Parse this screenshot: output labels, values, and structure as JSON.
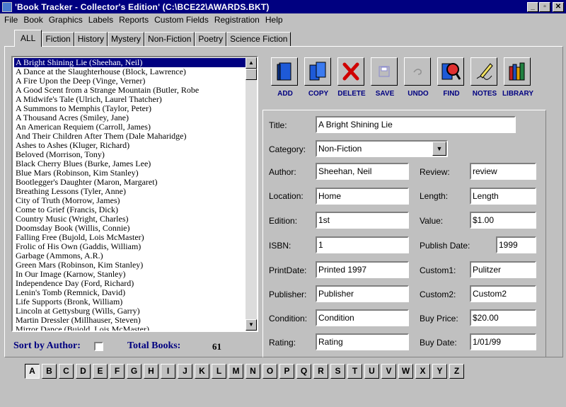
{
  "window": {
    "title": "'Book Tracker - Collector's Edition'    (C:\\BCE22\\AWARDS.BKT)"
  },
  "menu": [
    "File",
    "Book",
    "Graphics",
    "Labels",
    "Reports",
    "Custom Fields",
    "Registration",
    "Help"
  ],
  "tabs": [
    "ALL",
    "Fiction",
    "History",
    "Mystery",
    "Non-Fiction",
    "Poetry",
    "Science Fiction"
  ],
  "books": [
    "A Bright Shining Lie (Sheehan, Neil)",
    "A Dance at the Slaughterhouse (Block, Lawrence)",
    "A Fire Upon the Deep (Vinge, Verner)",
    "A Good Scent from a Strange Mountain (Butler, Robe",
    "A Midwife's Tale (Ulrich, Laurel Thatcher)",
    "A Summons to Memphis (Taylor, Peter)",
    "A Thousand Acres (Smiley, Jane)",
    "An American Requiem (Carroll, James)",
    "And Their Children After Them (Dale Maharidge)",
    "Ashes to Ashes (Kluger, Richard)",
    "Beloved (Morrison, Tony)",
    "Black Cherry Blues (Burke, James Lee)",
    "Blue Mars (Robinson, Kim Stanley)",
    "Bootlegger's Daughter (Maron, Margaret)",
    "Breathing Lessons (Tyler, Anne)",
    "City of Truth (Morrow, James)",
    "Come to Grief (Francis, Dick)",
    "Country Music (Wright, Charles)",
    "Doomsday Book (Willis, Connie)",
    "Falling Free (Bujold, Lois McMaster)",
    "Frolic of His Own (Gaddis, William)",
    "Garbage (Ammons, A.R.)",
    "Green Mars (Robinson, Kim Stanley)",
    "In Our Image (Karnow, Stanley)",
    "Independence Day (Ford, Richard)",
    "Lenin's Tomb (Remnick, David)",
    "Life Supports (Bronk, William)",
    "Lincoln at Gettysburg (Wills, Garry)",
    "Martin Dressler (Millhauser, Steven)",
    "Mirror Dance (Bujold, Lois McMaster)"
  ],
  "sort": {
    "label": "Sort by Author:"
  },
  "total": {
    "label": "Total Books:",
    "value": "61"
  },
  "toolbar": [
    "ADD",
    "COPY",
    "DELETE",
    "SAVE",
    "UNDO",
    "FIND",
    "NOTES",
    "LIBRARY"
  ],
  "form": {
    "title_label": "Title:",
    "title": "A Bright Shining Lie",
    "category_label": "Category:",
    "category": "Non-Fiction",
    "author_label": "Author:",
    "author": "Sheehan, Neil",
    "review_label": "Review:",
    "review": "review",
    "location_label": "Location:",
    "location": "Home",
    "length_label": "Length:",
    "length": "Length",
    "edition_label": "Edition:",
    "edition": "1st",
    "value_label": "Value:",
    "value": "$1.00",
    "isbn_label": "ISBN:",
    "isbn": "1",
    "publish_date_label": "Publish Date:",
    "publish_date": "1999",
    "print_date_label": "PrintDate:",
    "print_date": "Printed 1997",
    "custom1_label": "Custom1:",
    "custom1": "Pulitzer",
    "publisher_label": "Publisher:",
    "publisher": "Publisher",
    "custom2_label": "Custom2:",
    "custom2": "Custom2",
    "condition_label": "Condition:",
    "condition": "Condition",
    "buy_price_label": "Buy Price:",
    "buy_price": "$20.00",
    "rating_label": "Rating:",
    "rating": "Rating",
    "buy_date_label": "Buy Date:",
    "buy_date": "1/01/99"
  },
  "alphabet": [
    "A",
    "B",
    "C",
    "D",
    "E",
    "F",
    "G",
    "H",
    "I",
    "J",
    "K",
    "L",
    "M",
    "N",
    "O",
    "P",
    "Q",
    "R",
    "S",
    "T",
    "U",
    "V",
    "W",
    "X",
    "Y",
    "Z"
  ]
}
